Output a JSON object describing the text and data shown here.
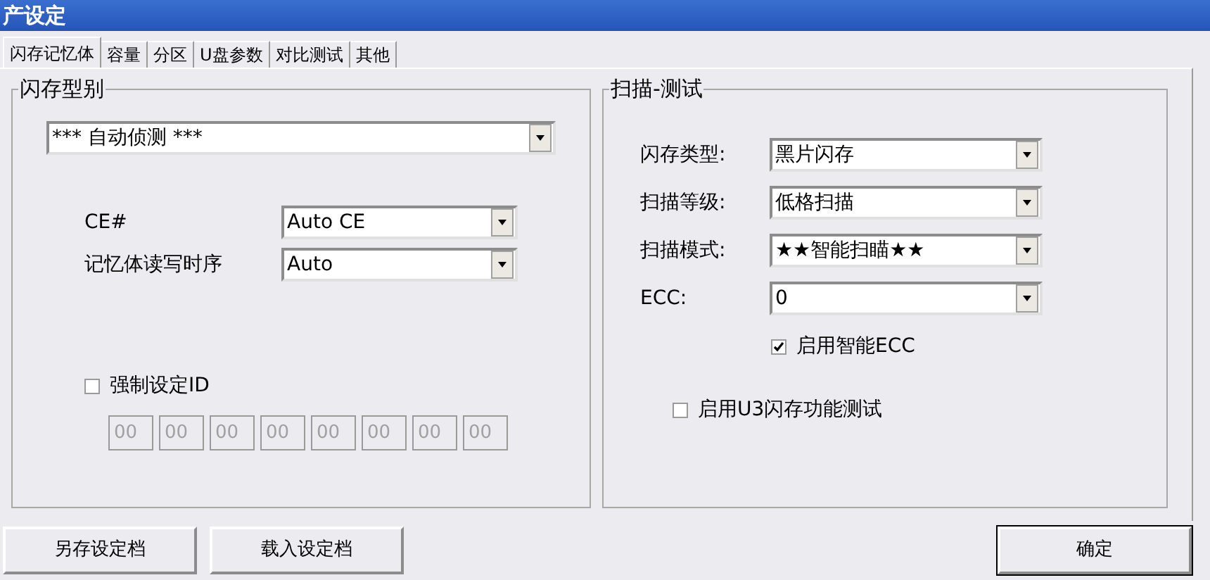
{
  "window": {
    "title": "产设定"
  },
  "tabs": [
    {
      "label": "闪存记忆体",
      "selected": true
    },
    {
      "label": "容量",
      "selected": false
    },
    {
      "label": "分区",
      "selected": false
    },
    {
      "label": "U盘参数",
      "selected": false
    },
    {
      "label": "对比测试",
      "selected": false
    },
    {
      "label": "其他",
      "selected": false
    }
  ],
  "flash_model": {
    "title": "闪存型别",
    "detect": {
      "value": "*** 自动侦测 ***"
    },
    "fields": [
      {
        "label": "CE#",
        "value": "Auto CE"
      },
      {
        "label": "记忆体读写时序",
        "value": "Auto"
      }
    ],
    "force_id": {
      "label": "强制设定ID",
      "checked": false
    },
    "id_bytes": [
      "00",
      "00",
      "00",
      "00",
      "00",
      "00",
      "00",
      "00"
    ]
  },
  "scan_test": {
    "title": "扫描-测试",
    "fields": [
      {
        "label": "闪存类型:",
        "value": "黑片闪存"
      },
      {
        "label": "扫描等级:",
        "value": "低格扫描"
      },
      {
        "label": "扫描模式:",
        "value": "★★智能扫瞄★★"
      },
      {
        "label": "ECC:",
        "value": "0"
      }
    ],
    "smart_ecc": {
      "label": "启用智能ECC",
      "checked": true
    },
    "u3_test": {
      "label": "启用U3闪存功能测试",
      "checked": false
    }
  },
  "buttons": [
    "另存设定档",
    "载入设定档",
    "确定"
  ]
}
